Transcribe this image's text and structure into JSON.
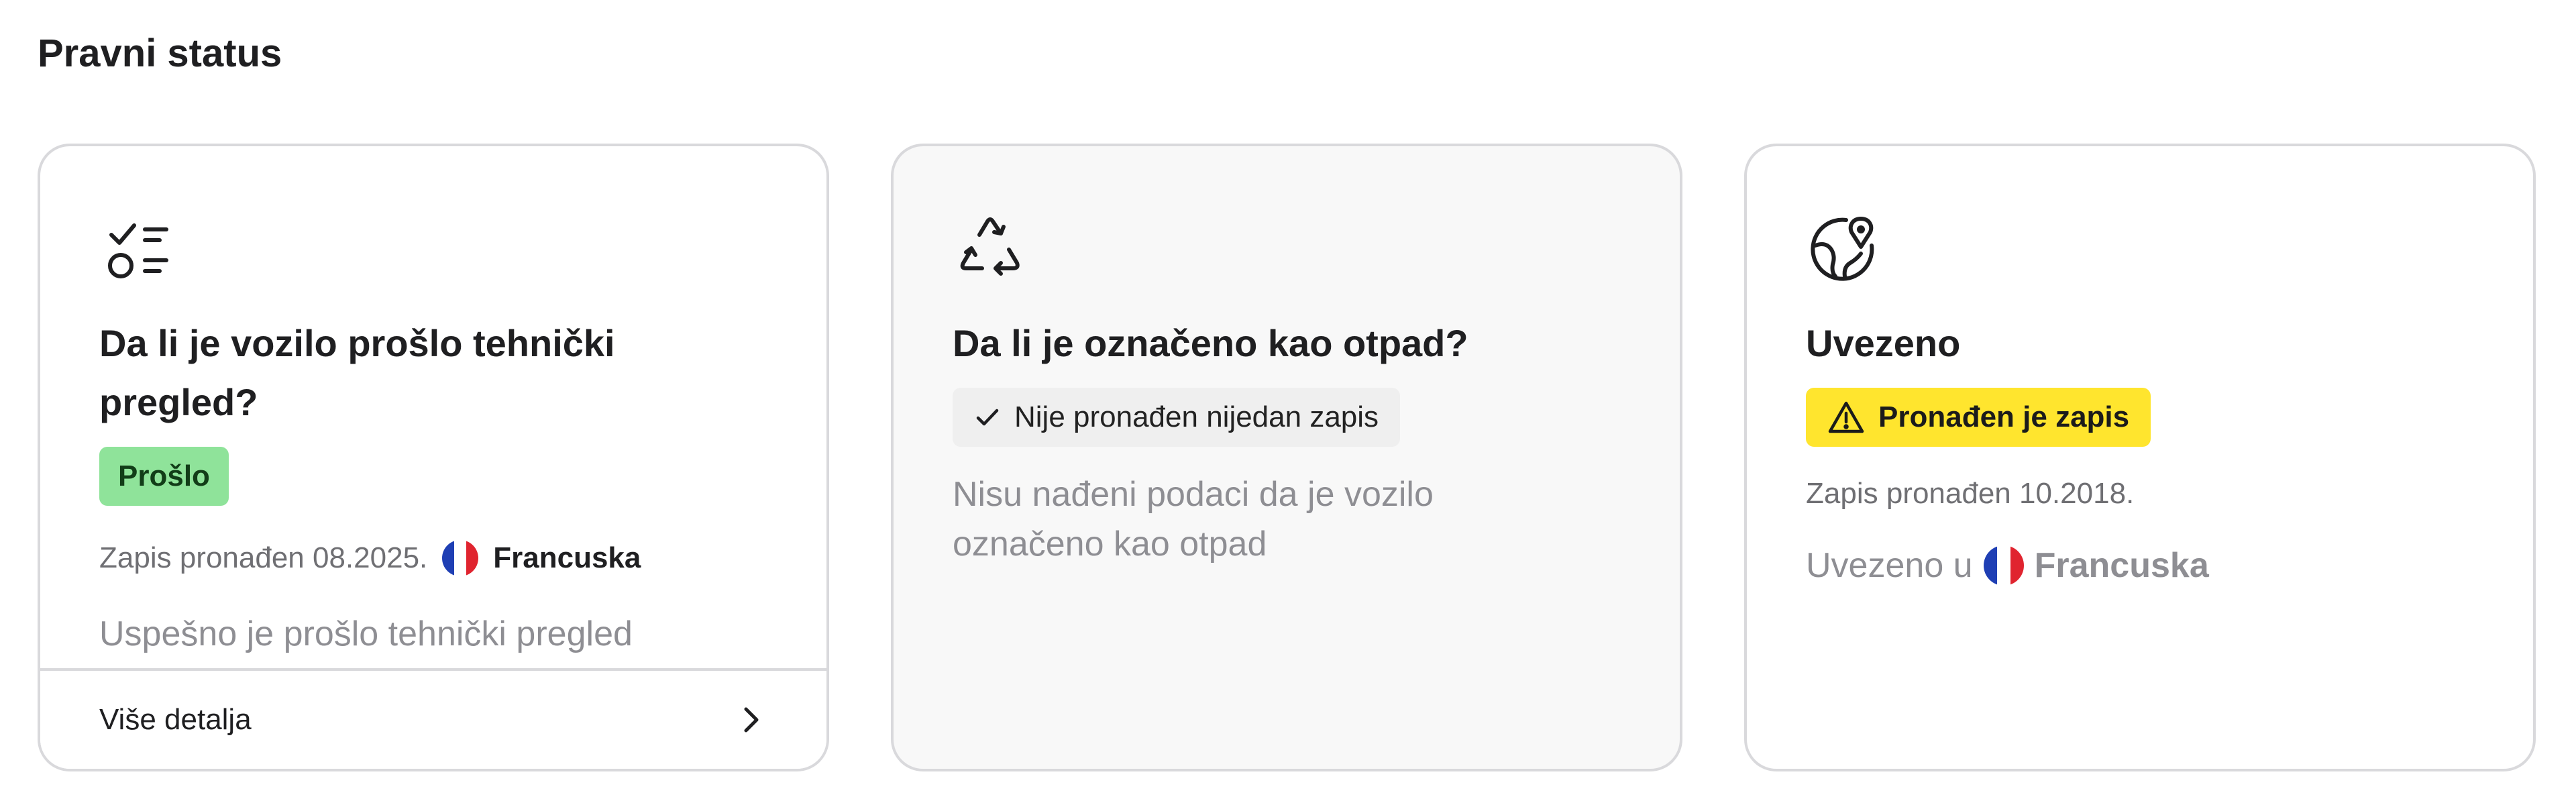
{
  "section": {
    "title": "Pravni status"
  },
  "cards": [
    {
      "icon": "checklist-icon",
      "title": "Da li je vozilo prošlo tehnički pregled?",
      "badge": "Prošlo",
      "record": "Zapis pronađen 08.2025.",
      "country": "Francuska",
      "description": "Uspešno je prošlo tehnički pregled",
      "footer_label": "Više detalja"
    },
    {
      "icon": "recycle-icon",
      "title": "Da li je označeno kao otpad?",
      "badge": "Nije pronađen nijedan zapis",
      "description": "Nisu nađeni podaci da je vozilo označeno kao otpad"
    },
    {
      "icon": "globe-pin-icon",
      "title": "Uvezeno",
      "badge": "Pronađen je zapis",
      "record": "Zapis pronađen 10.2018.",
      "imported_prefix": "Uvezeno u",
      "country": "Francuska"
    }
  ],
  "colors": {
    "pass_badge": "#8fe39a",
    "found_badge": "#ffe52e",
    "none_badge": "#efefef",
    "flag_blue": "#1f3fb4",
    "flag_white": "#ffffff",
    "flag_red": "#e0242f"
  }
}
